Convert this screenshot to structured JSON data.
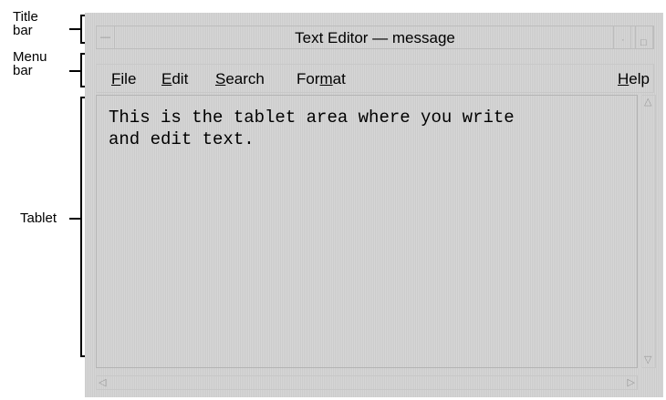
{
  "callouts": {
    "title_bar": "Title\nbar",
    "menu_bar": "Menu\nbar",
    "tablet": "Tablet"
  },
  "window": {
    "title": "Text Editor — message"
  },
  "menubar": {
    "items": [
      {
        "label": "File",
        "mnemonic": "F"
      },
      {
        "label": "Edit",
        "mnemonic": "E"
      },
      {
        "label": "Search",
        "mnemonic": "S"
      },
      {
        "label": "Format",
        "mnemonic": "m"
      },
      {
        "label": "Help",
        "mnemonic": "H"
      }
    ]
  },
  "tablet": {
    "text": "This is the tablet area where you write\nand edit text."
  },
  "icons": {
    "scroll_up": "triangle-up-icon",
    "scroll_down": "triangle-down-icon",
    "scroll_left": "triangle-left-icon",
    "scroll_right": "triangle-right-icon"
  }
}
